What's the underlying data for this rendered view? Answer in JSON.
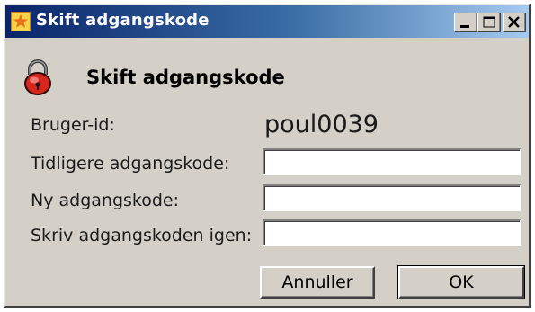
{
  "window": {
    "title": "Skift adgangskode",
    "controls": {
      "minimize": "minimize",
      "maximize": "maximize",
      "close": "close"
    }
  },
  "header": {
    "title": "Skift adgangskode",
    "icon": "padlock-icon"
  },
  "form": {
    "userid_label": "Bruger-id:",
    "userid_value": "poul0039",
    "old_password_label": "Tidligere adgangskode:",
    "old_password_value": "",
    "new_password_label": "Ny adgangskode:",
    "new_password_value": "",
    "confirm_password_label": "Skriv adgangskoden igen:",
    "confirm_password_value": ""
  },
  "buttons": {
    "cancel_label": "Annuller",
    "ok_label": "OK"
  },
  "colors": {
    "window_bg": "#d4d0c8",
    "titlebar_start": "#0a246a",
    "titlebar_end": "#a6caf0",
    "lock_red": "#d7261e"
  }
}
